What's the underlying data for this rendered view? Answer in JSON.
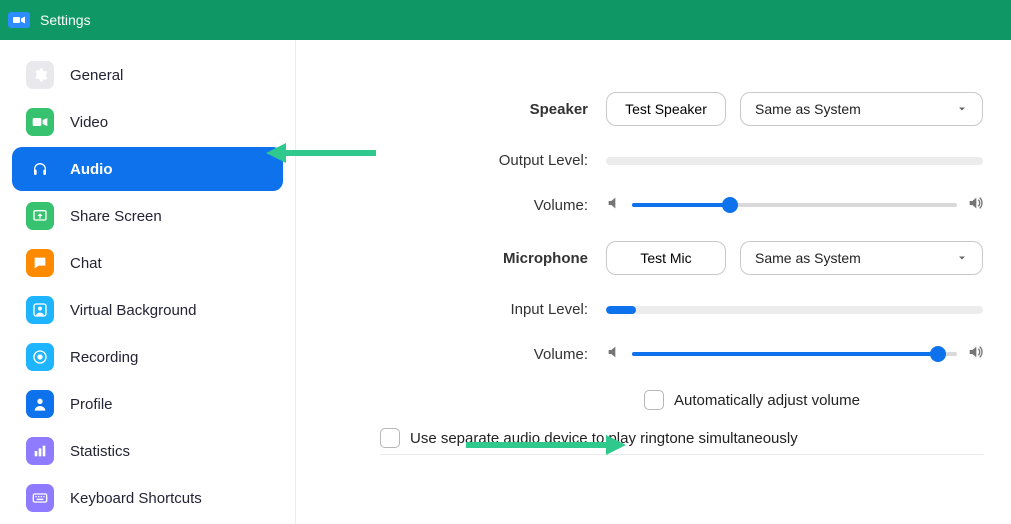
{
  "titlebar": {
    "title": "Settings"
  },
  "sidebar": {
    "items": [
      {
        "label": "General"
      },
      {
        "label": "Video"
      },
      {
        "label": "Audio"
      },
      {
        "label": "Share Screen"
      },
      {
        "label": "Chat"
      },
      {
        "label": "Virtual Background"
      },
      {
        "label": "Recording"
      },
      {
        "label": "Profile"
      },
      {
        "label": "Statistics"
      },
      {
        "label": "Keyboard Shortcuts"
      }
    ]
  },
  "audio": {
    "speaker": {
      "title": "Speaker",
      "test_label": "Test Speaker",
      "device": "Same as System",
      "output_label": "Output Level:",
      "volume_label": "Volume:",
      "output_level_pct": 0,
      "volume_pct": 30
    },
    "microphone": {
      "title": "Microphone",
      "test_label": "Test Mic",
      "device": "Same as System",
      "input_label": "Input Level:",
      "volume_label": "Volume:",
      "input_level_pct": 8,
      "volume_pct": 94,
      "auto_adjust_label": "Automatically adjust volume"
    },
    "ringtone_label": "Use separate audio device to play ringtone simultaneously"
  }
}
